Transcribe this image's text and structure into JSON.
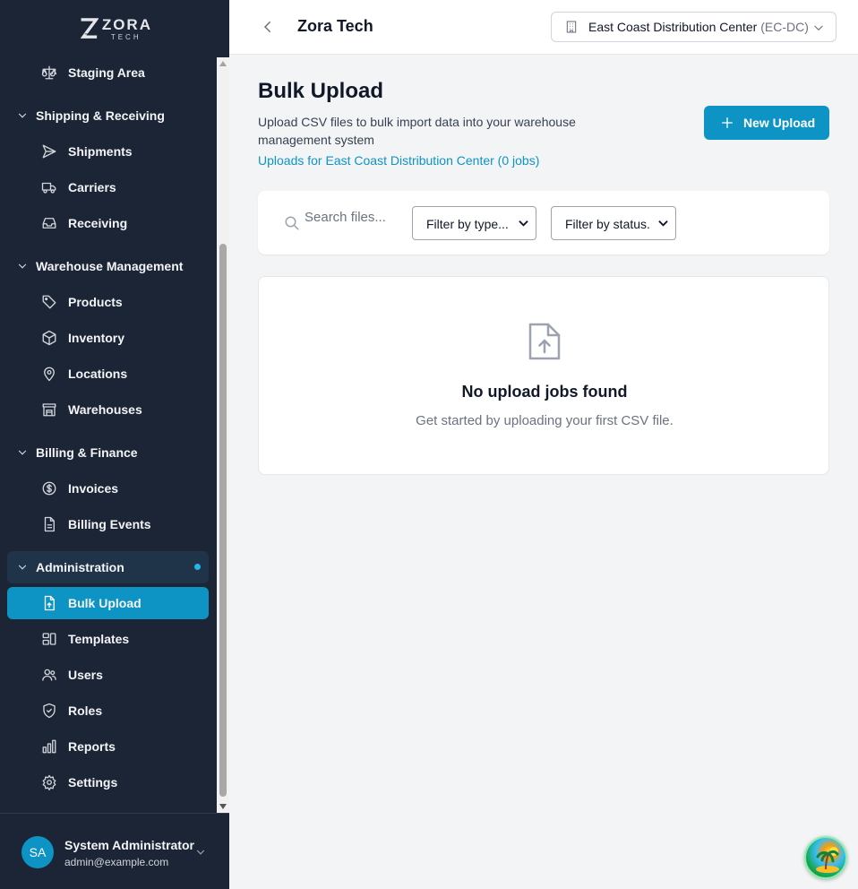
{
  "brand": {
    "name": "ZORA",
    "sub": "TECH"
  },
  "sidebar": {
    "items": [
      {
        "id": "staging",
        "label": "Staging Area",
        "icon": "scale-icon"
      },
      {
        "id": "sec-shipping",
        "label": "Shipping & Receiving",
        "section": true
      },
      {
        "id": "shipments",
        "label": "Shipments",
        "icon": "send-icon"
      },
      {
        "id": "carriers",
        "label": "Carriers",
        "icon": "truck-icon"
      },
      {
        "id": "receiving",
        "label": "Receiving",
        "icon": "inbox-icon"
      },
      {
        "id": "sec-warehouse",
        "label": "Warehouse Management",
        "section": true
      },
      {
        "id": "products",
        "label": "Products",
        "icon": "tag-icon"
      },
      {
        "id": "inventory",
        "label": "Inventory",
        "icon": "box-icon"
      },
      {
        "id": "locations",
        "label": "Locations",
        "icon": "map-pin-icon"
      },
      {
        "id": "warehouses",
        "label": "Warehouses",
        "icon": "warehouse-icon"
      },
      {
        "id": "sec-billing",
        "label": "Billing & Finance",
        "section": true
      },
      {
        "id": "invoices",
        "label": "Invoices",
        "icon": "dollar-circle-icon"
      },
      {
        "id": "billing-events",
        "label": "Billing Events",
        "icon": "file-text-icon"
      },
      {
        "id": "sec-admin",
        "label": "Administration",
        "section": true
      },
      {
        "id": "bulk-upload",
        "label": "Bulk Upload",
        "icon": "file-upload-icon"
      },
      {
        "id": "templates",
        "label": "Templates",
        "icon": "layout-icon"
      },
      {
        "id": "users",
        "label": "Users",
        "icon": "users-icon"
      },
      {
        "id": "roles",
        "label": "Roles",
        "icon": "shield-icon"
      },
      {
        "id": "reports",
        "label": "Reports",
        "icon": "bar-chart-icon"
      },
      {
        "id": "settings",
        "label": "Settings",
        "icon": "gear-icon"
      }
    ]
  },
  "user": {
    "initials": "SA",
    "name": "System Administrator",
    "email": "admin@example.com"
  },
  "header": {
    "company": "Zora Tech",
    "warehouse_name": "East Coast Distribution Center",
    "warehouse_code": "(EC-DC)"
  },
  "main": {
    "title": "Bulk Upload",
    "description": "Upload CSV files to bulk import data into your warehouse management system",
    "link": "Uploads for East Coast Distribution Center (0 jobs)",
    "new_button": "New Upload",
    "search_placeholder": "Search files...",
    "filter_type": "Filter by type...",
    "filter_status": "Filter by status.",
    "empty_title": "No upload jobs found",
    "empty_sub": "Get started by uploading your first CSV file."
  },
  "colors": {
    "accent": "#0d94c4",
    "sidebar_bg": "#1b2535"
  }
}
